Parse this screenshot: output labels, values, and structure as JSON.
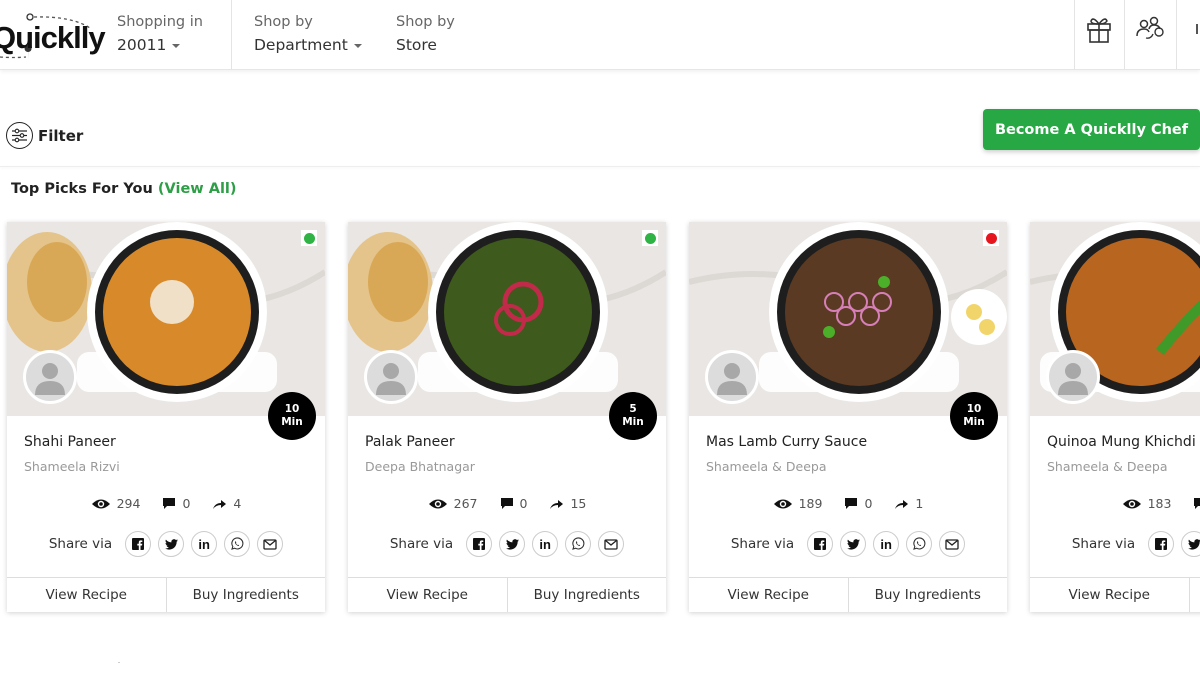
{
  "header": {
    "logo_text": "Quicklly",
    "location": {
      "label": "Shopping in",
      "value": "20011"
    },
    "department": {
      "label": "Shop by",
      "value": "Department"
    },
    "store": {
      "label": "Shop by",
      "value": "Store"
    },
    "icons": [
      "gift-icon",
      "refer-friends-icon"
    ]
  },
  "toolbar": {
    "filter_label": "Filter",
    "chef_button_label": "Become A Quicklly Chef"
  },
  "section": {
    "title": "Top Picks For You",
    "view_all": "(View All)"
  },
  "colors": {
    "accent": "#28a745",
    "veg": "#2fb344",
    "non_veg": "#e5161e"
  },
  "share_label": "Share via",
  "view_recipe_label": "View Recipe",
  "buy_ingredients_label": "Buy Ingredients",
  "time_unit": "Min",
  "cards": [
    {
      "title": "Shahi Paneer",
      "author": "Shameela Rizvi",
      "time": "10",
      "views": "294",
      "comments": "0",
      "shares": "4",
      "diet": "veg"
    },
    {
      "title": "Palak Paneer",
      "author": "Deepa Bhatnagar",
      "time": "5",
      "views": "267",
      "comments": "0",
      "shares": "15",
      "diet": "veg"
    },
    {
      "title": "Mas Lamb Curry Sauce",
      "author": "Shameela & Deepa",
      "time": "10",
      "views": "189",
      "comments": "0",
      "shares": "1",
      "diet": "non-veg"
    },
    {
      "title": "Quinoa Mung Khichdi",
      "author": "Shameela & Deepa",
      "time": "",
      "views": "183",
      "comments": "",
      "shares": "",
      "diet": "veg"
    }
  ]
}
